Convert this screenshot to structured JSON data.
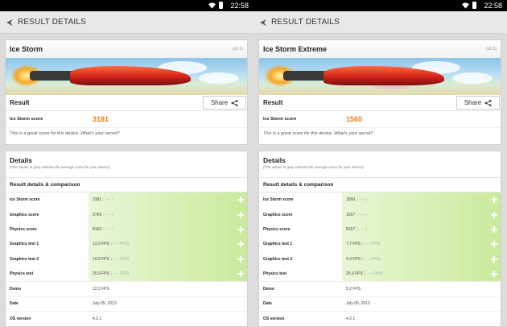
{
  "status": {
    "time": "22:58"
  },
  "screens": [
    {
      "app_title": "RESULT DETAILS",
      "test_name": "Ice Storm",
      "version": "(v1.1)",
      "result_label": "Result",
      "share_label": "Share",
      "score_label": "Ice Storm score",
      "score_value": "3181",
      "note": "This is a great score for this device. What's your secret?",
      "details_title": "Details",
      "details_subtitle": "(The values in grey indicate the average score for your device)",
      "comparison_title": "Result details & comparison",
      "rows": [
        {
          "label": "Ice Storm score",
          "value": "3181",
          "avg": "( ---- )"
        },
        {
          "label": "Graphics score",
          "value": "2709",
          "avg": "( ---- )"
        },
        {
          "label": "Physics score",
          "value": "8163",
          "avg": "( ---- )"
        },
        {
          "label": "Graphics test 1",
          "value": "13.2 FPS",
          "avg": "( ---- FPS)"
        },
        {
          "label": "Graphics test 2",
          "value": "10.6 FPS",
          "avg": "( ---- FPS)"
        },
        {
          "label": "Physics test",
          "value": "25.9 FPS",
          "avg": "( ---- FPS)"
        }
      ],
      "info": [
        {
          "label": "Demo",
          "value": "12.2 FPS"
        },
        {
          "label": "Date",
          "value": "July 05, 2013"
        },
        {
          "label": "OS version",
          "value": "4.2.1"
        }
      ]
    },
    {
      "app_title": "RESULT DETAILS",
      "test_name": "Ice Storm Extreme",
      "version": "(v1.1)",
      "result_label": "Result",
      "share_label": "Share",
      "score_label": "Ice Storm score",
      "score_value": "1560",
      "note": "This is a great score for this device. What's your secret?",
      "details_title": "Details",
      "details_subtitle": "(The values in grey indicate the average score for your device)",
      "comparison_title": "Result details & comparison",
      "rows": [
        {
          "label": "Ice Storm score",
          "value": "1560",
          "avg": "( ---- )"
        },
        {
          "label": "Graphics score",
          "value": "1267",
          "avg": "( ---- )"
        },
        {
          "label": "Physics score",
          "value": "8157",
          "avg": "( ---- )"
        },
        {
          "label": "Graphics test 1",
          "value": "7.7 FPS",
          "avg": "( ---- FPS)"
        },
        {
          "label": "Graphics test 2",
          "value": "4.3 FPS",
          "avg": "( ---- FPS)"
        },
        {
          "label": "Physics test",
          "value": "25.9 FPS",
          "avg": "( ---- FPS)"
        }
      ],
      "info": [
        {
          "label": "Demo",
          "value": "5.2 FPS"
        },
        {
          "label": "Date",
          "value": "July 05, 2013"
        },
        {
          "label": "OS version",
          "value": "4.2.1"
        }
      ]
    }
  ],
  "colors": {
    "score": "#f07d1a",
    "compare_bar": "#c9ea9c"
  },
  "icons": [
    "wifi-icon",
    "battery-icon",
    "back-icon",
    "share-icon",
    "plus-icon"
  ]
}
